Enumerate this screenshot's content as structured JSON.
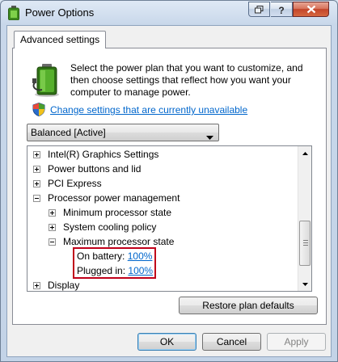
{
  "window": {
    "title": "Power Options",
    "app_icon": "power-options-icon"
  },
  "tab": {
    "label": "Advanced settings"
  },
  "description": "Select the power plan that you want to customize, and then choose settings that reflect how you want your computer to manage power.",
  "change_settings_link": "Change settings that are currently unavailable",
  "plan_select": {
    "selected": "Balanced [Active]"
  },
  "tree": {
    "items": [
      {
        "label": "Intel(R) Graphics Settings",
        "expanded": false
      },
      {
        "label": "Power buttons and lid",
        "expanded": false
      },
      {
        "label": "PCI Express",
        "expanded": false
      },
      {
        "label": "Processor power management",
        "expanded": true
      },
      {
        "label": "Minimum processor state",
        "expanded": false
      },
      {
        "label": "System cooling policy",
        "expanded": false
      },
      {
        "label": "Maximum processor state",
        "expanded": true
      },
      {
        "label": "Display",
        "expanded": false
      }
    ],
    "settings": [
      {
        "label": "On battery:",
        "value": "100%"
      },
      {
        "label": "Plugged in:",
        "value": "100%"
      }
    ]
  },
  "buttons": {
    "restore_defaults": "Restore plan defaults",
    "ok": "OK",
    "cancel": "Cancel",
    "apply": "Apply"
  },
  "colors": {
    "link": "#0066cc",
    "highlight_border": "#c0001a",
    "close_button": "#c3452a"
  }
}
